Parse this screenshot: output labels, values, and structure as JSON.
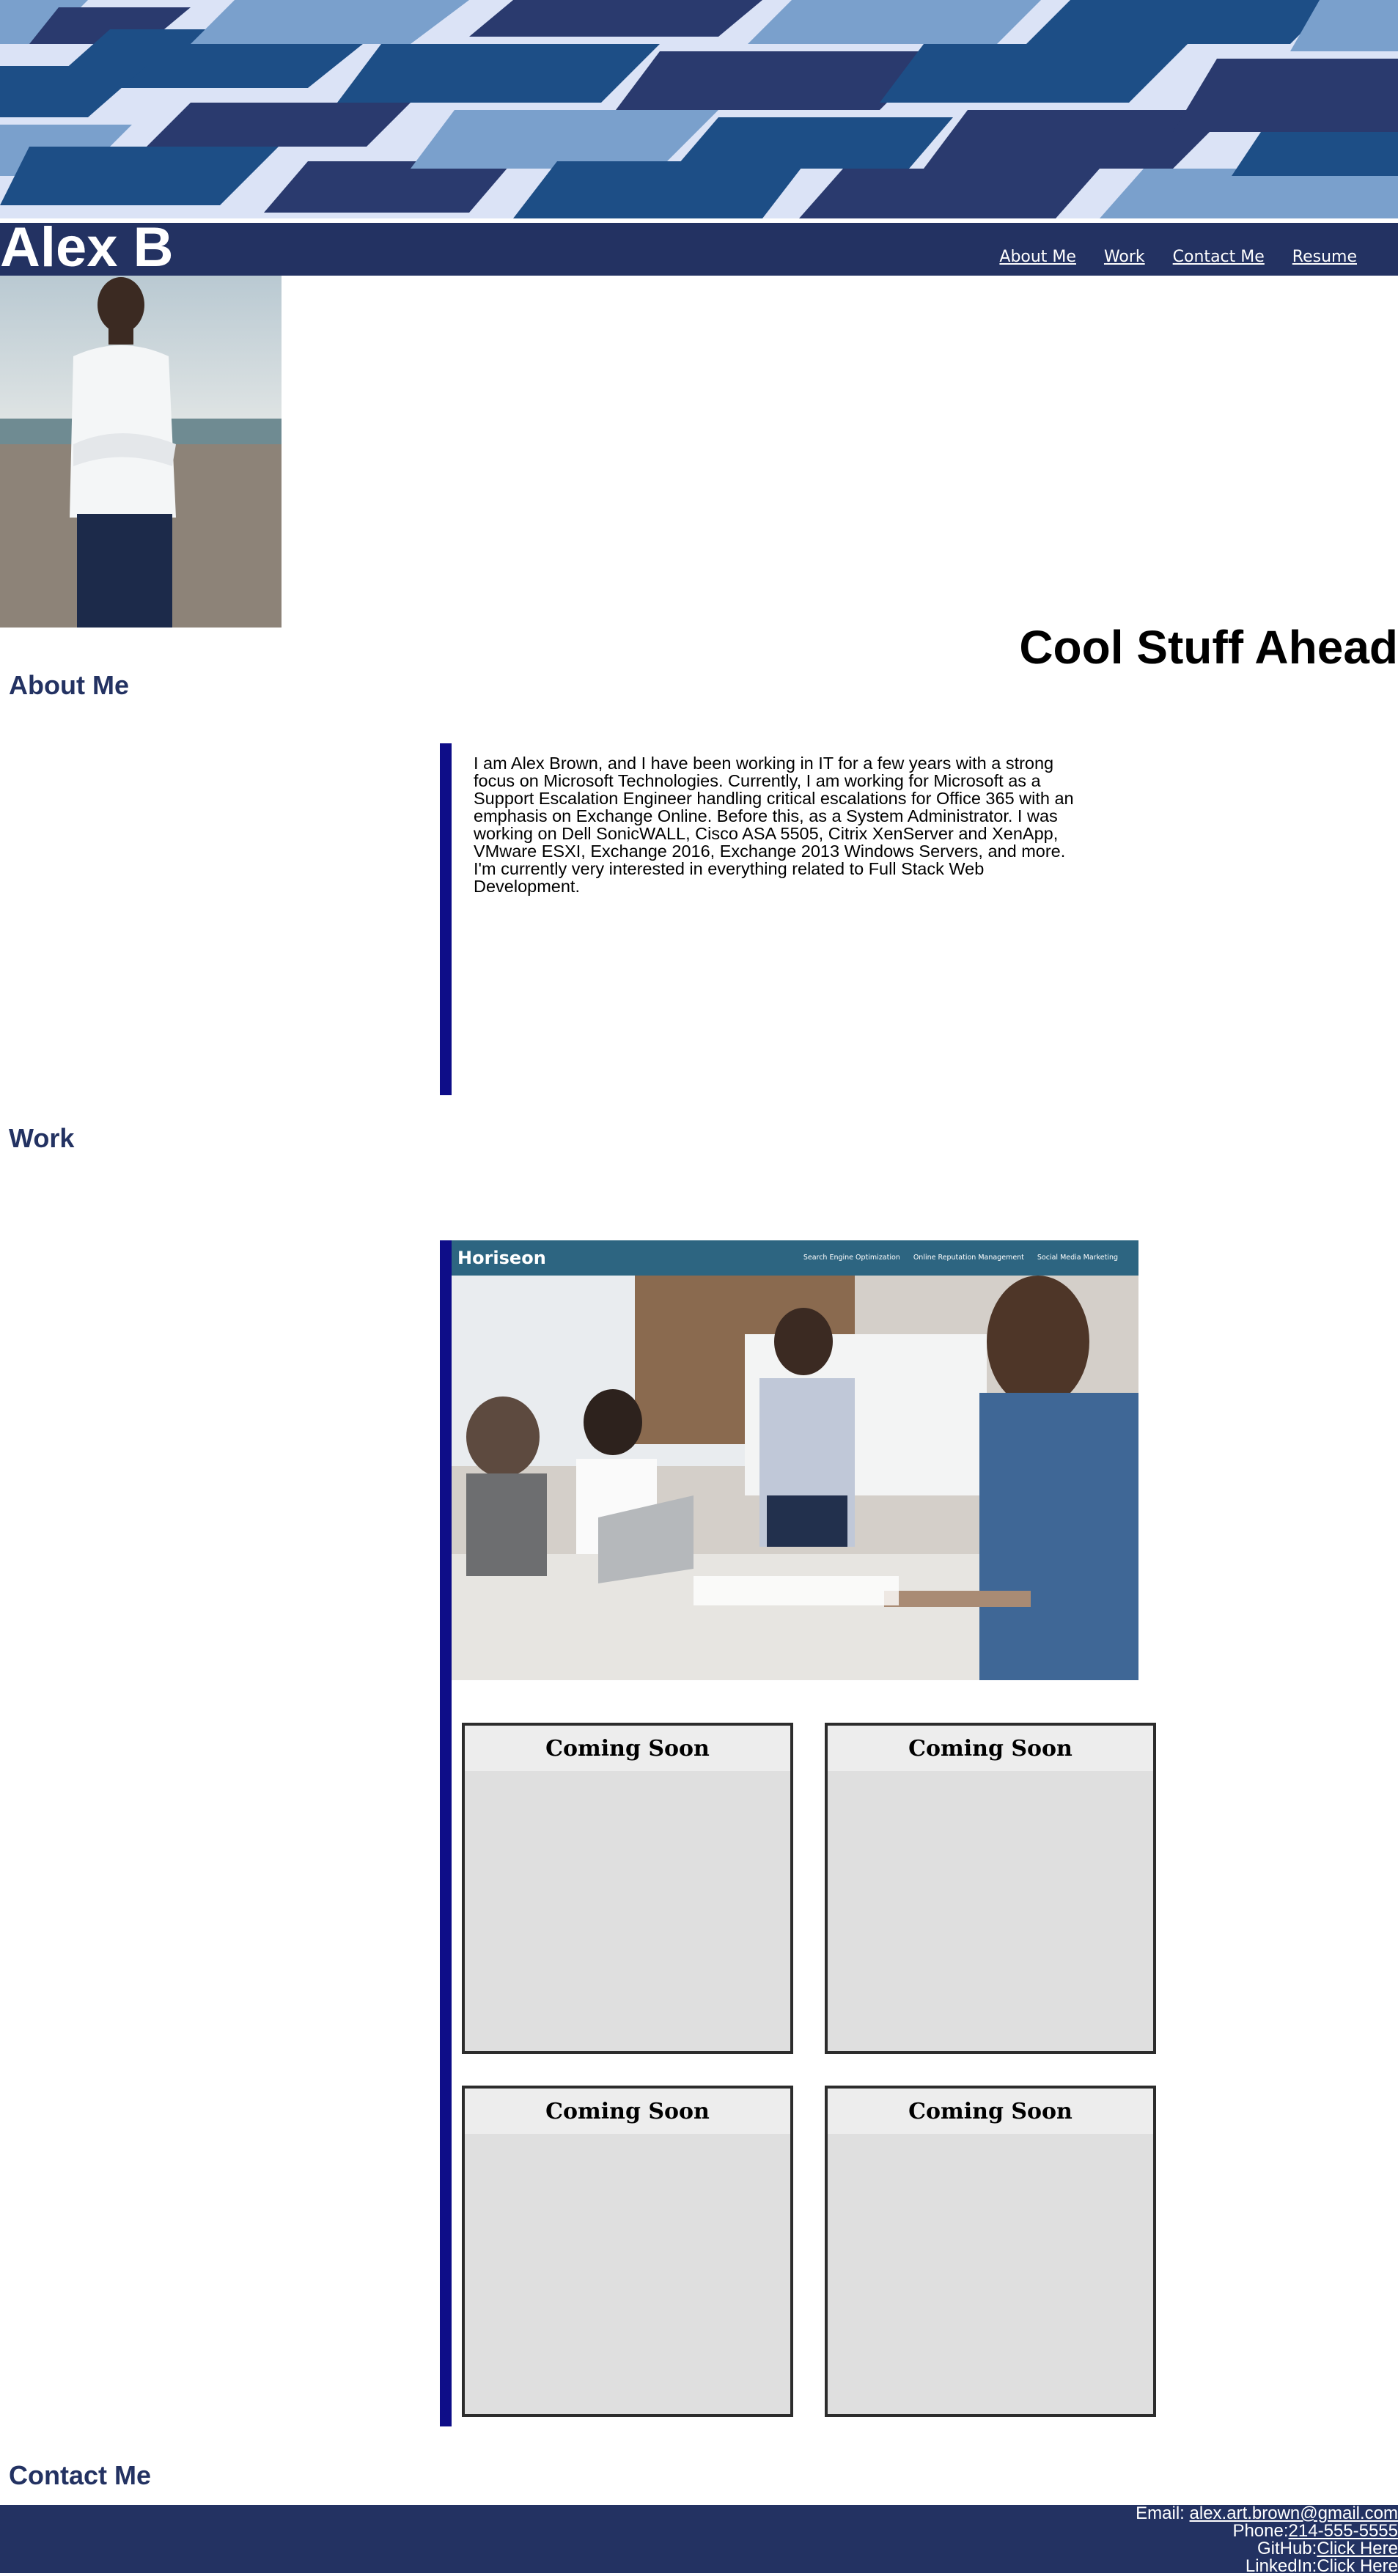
{
  "header": {
    "name": "Alex B",
    "nav": [
      "About Me",
      "Work",
      "Contact Me",
      "Resume"
    ]
  },
  "hero": {
    "tagline": "Cool Stuff Ahead"
  },
  "about": {
    "heading": "About Me",
    "text": "I am Alex Brown, and I have been working in IT for a few years with a strong focus on Microsoft Technologies. Currently, I am working for Microsoft as a Support Escalation Engineer handling critical escalations for Office 365 with an emphasis on Exchange Online. Before this, as a System Administrator. I was working on Dell SonicWALL, Cisco ASA 5505, Citrix XenServer and XenApp, VMware ESXI, Exchange 2016, Exchange 2013 Windows Servers, and more. I'm currently very interested in everything related to Full Stack Web Development."
  },
  "work": {
    "heading": "Work",
    "featured": {
      "title": "Horiseon",
      "links": [
        "Search Engine Optimization",
        "Online Reputation Management",
        "Social Media Marketing"
      ]
    },
    "placeholders": [
      "Coming Soon",
      "Coming Soon",
      "Coming Soon",
      "Coming Soon"
    ]
  },
  "contact": {
    "heading": "Contact Me",
    "email_label": "Email: ",
    "email": "alex.art.brown@gmail.com",
    "phone_label": "Phone:",
    "phone": "214-555-5555",
    "github_label": "GitHub:",
    "github": "Click Here",
    "linkedin_label": "LinkedIn:",
    "linkedin": "Click Here"
  },
  "colors": {
    "navy": "#233262",
    "accent_bar": "#0e0d88",
    "heading": "#233262"
  }
}
